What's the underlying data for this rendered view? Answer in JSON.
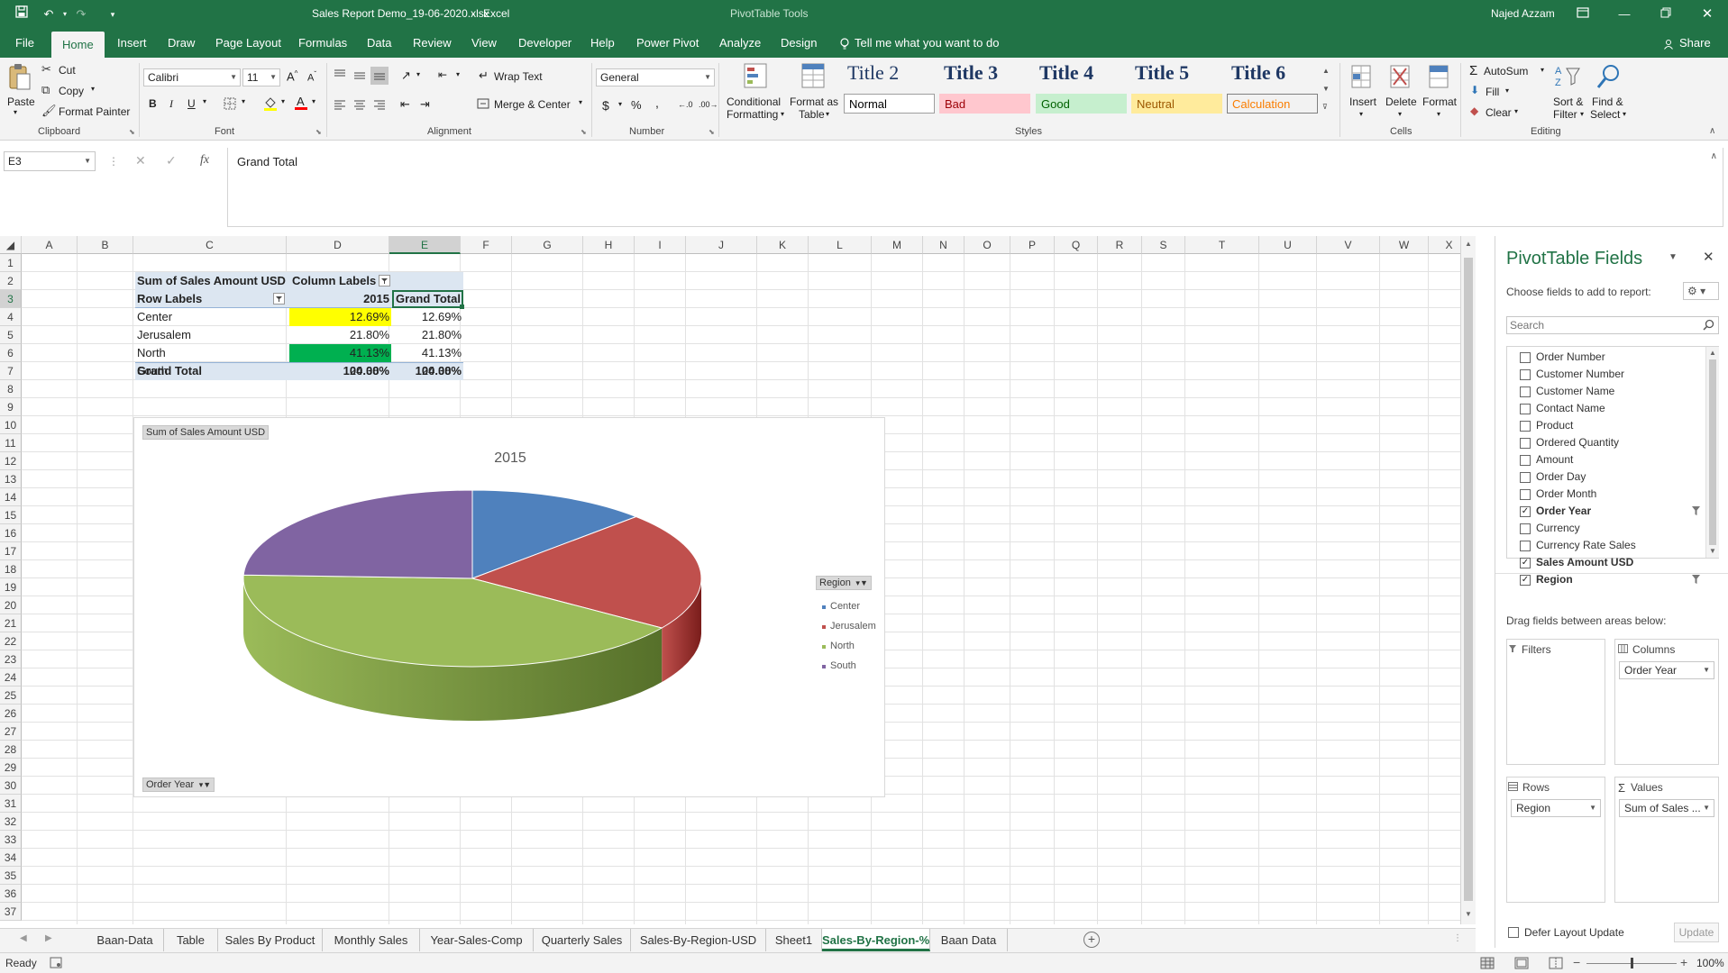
{
  "title_bar": {
    "file_title": "Sales Report Demo_19-06-2020.xlsx",
    "app_name": "Excel",
    "tool_context": "PivotTable Tools",
    "user_name": "Najed Azzam"
  },
  "menu": {
    "tabs": [
      "File",
      "Home",
      "Insert",
      "Draw",
      "Page Layout",
      "Formulas",
      "Data",
      "Review",
      "View",
      "Developer",
      "Help",
      "Power Pivot",
      "Analyze",
      "Design"
    ],
    "active_tab": "Home",
    "tell_me": "Tell me what you want to do",
    "share": "Share"
  },
  "ribbon": {
    "clipboard": {
      "paste": "Paste",
      "cut": "Cut",
      "copy": "Copy",
      "format_painter": "Format Painter",
      "label": "Clipboard"
    },
    "font": {
      "name": "Calibri",
      "size": "11",
      "bold": "B",
      "italic": "I",
      "underline": "U",
      "label": "Font"
    },
    "alignment": {
      "wrap_text": "Wrap Text",
      "merge_center": "Merge & Center",
      "label": "Alignment"
    },
    "number": {
      "format": "General",
      "currency": "$",
      "percent": "%",
      "comma": ",",
      "label": "Number"
    },
    "styles": {
      "conditional_formatting": "Conditional",
      "conditional_formatting_2": "Formatting",
      "format_as_table": "Format as",
      "format_as_table_2": "Table",
      "titles": [
        "Title 2",
        "Title 3",
        "Title 4",
        "Title 5",
        "Title 6"
      ],
      "cells": [
        {
          "label": "Normal",
          "bg": "#ffffff",
          "fg": "#000000",
          "border": "#9e9e9e"
        },
        {
          "label": "Bad",
          "bg": "#ffc7ce",
          "fg": "#9c0006",
          "border": "#ffc7ce"
        },
        {
          "label": "Good",
          "bg": "#c6efce",
          "fg": "#006100",
          "border": "#c6efce"
        },
        {
          "label": "Neutral",
          "bg": "#ffeb9c",
          "fg": "#9c5700",
          "border": "#ffeb9c"
        },
        {
          "label": "Calculation",
          "bg": "#f2f2f2",
          "fg": "#fa7d00",
          "border": "#7f7f7f"
        }
      ],
      "label": "Styles"
    },
    "cells": {
      "insert": "Insert",
      "delete": "Delete",
      "format": "Format",
      "label": "Cells"
    },
    "editing": {
      "autosum": "AutoSum",
      "fill": "Fill",
      "clear": "Clear",
      "sort_filter": "Sort &",
      "sort_filter_2": "Filter",
      "find_select": "Find &",
      "find_select_2": "Select",
      "label": "Editing"
    }
  },
  "formula_bar": {
    "name_box": "E3",
    "content": "Grand Total"
  },
  "grid": {
    "columns": [
      "A",
      "B",
      "C",
      "D",
      "E",
      "F",
      "G",
      "H",
      "I",
      "J",
      "K",
      "L",
      "M",
      "N",
      "O",
      "P",
      "Q",
      "R",
      "S",
      "T",
      "U",
      "V",
      "W",
      "X"
    ],
    "selected_column": "E",
    "selected_row": 3,
    "rows": 37
  },
  "pivot_table": {
    "header_left": "Sum of Sales Amount USD",
    "header_col_labels": "Column Labels",
    "row_labels": "Row Labels",
    "year": "2015",
    "grand_total": "Grand Total",
    "rows": [
      {
        "label": "Center",
        "value": "12.69%",
        "total": "12.69%",
        "highlight": "#ffff00"
      },
      {
        "label": "Jerusalem",
        "value": "21.80%",
        "total": "21.80%",
        "highlight": ""
      },
      {
        "label": "North",
        "value": "41.13%",
        "total": "41.13%",
        "highlight": "#00b050"
      },
      {
        "label": "South",
        "value": "24.38%",
        "total": "24.38%",
        "highlight": ""
      }
    ],
    "total_row": {
      "label": "Grand Total",
      "value": "100.00%",
      "total": "100.00%"
    }
  },
  "chart_data": {
    "type": "pie",
    "title": "2015",
    "value_field": "Sum of Sales Amount USD",
    "filter_field": "Order Year",
    "legend_title": "Region",
    "legend_position": "right",
    "categories": [
      "Center",
      "Jerusalem",
      "North",
      "South"
    ],
    "values": [
      12.69,
      21.8,
      41.13,
      24.38
    ],
    "colors": [
      "#4f81bd",
      "#c0504d",
      "#9bbb59",
      "#8064a2"
    ],
    "shading": [
      "#2f5a8f",
      "#7a1d1b",
      "#56702a",
      "#4e3a6e"
    ],
    "style": "3d"
  },
  "pivot_pane": {
    "title": "PivotTable Fields",
    "choose_label": "Choose fields to add to report:",
    "search_placeholder": "Search",
    "fields": [
      {
        "name": "Order Number",
        "checked": false,
        "bold": false,
        "filter": false
      },
      {
        "name": "Customer Number",
        "checked": false,
        "bold": false,
        "filter": false
      },
      {
        "name": "Customer Name",
        "checked": false,
        "bold": false,
        "filter": false
      },
      {
        "name": "Contact Name",
        "checked": false,
        "bold": false,
        "filter": false
      },
      {
        "name": "Product",
        "checked": false,
        "bold": false,
        "filter": false
      },
      {
        "name": "Ordered Quantity",
        "checked": false,
        "bold": false,
        "filter": false
      },
      {
        "name": "Amount",
        "checked": false,
        "bold": false,
        "filter": false
      },
      {
        "name": "Order Day",
        "checked": false,
        "bold": false,
        "filter": false
      },
      {
        "name": "Order Month",
        "checked": false,
        "bold": false,
        "filter": false
      },
      {
        "name": "Order Year",
        "checked": true,
        "bold": true,
        "filter": true
      },
      {
        "name": "Currency",
        "checked": false,
        "bold": false,
        "filter": false
      },
      {
        "name": "Currency Rate Sales",
        "checked": false,
        "bold": false,
        "filter": false
      },
      {
        "name": "Sales Amount USD",
        "checked": true,
        "bold": true,
        "filter": false
      },
      {
        "name": "Region",
        "checked": true,
        "bold": true,
        "filter": true
      }
    ],
    "drag_label": "Drag fields between areas below:",
    "filters_title": "Filters",
    "columns_title": "Columns",
    "rows_title": "Rows",
    "values_title": "Values",
    "columns_item": "Order Year",
    "rows_item": "Region",
    "values_item": "Sum of Sales ...",
    "defer_label": "Defer Layout Update",
    "update_button": "Update"
  },
  "sheet_tabs": {
    "tabs": [
      "Baan-Data",
      "Table",
      "Sales By Product",
      "Monthly Sales",
      "Year-Sales-Comp",
      "Quarterly Sales",
      "Sales-By-Region-USD",
      "Sheet1",
      "Sales-By-Region-%",
      "Baan Data"
    ],
    "active": "Sales-By-Region-%"
  },
  "status": {
    "ready": "Ready",
    "zoom": "100%"
  }
}
